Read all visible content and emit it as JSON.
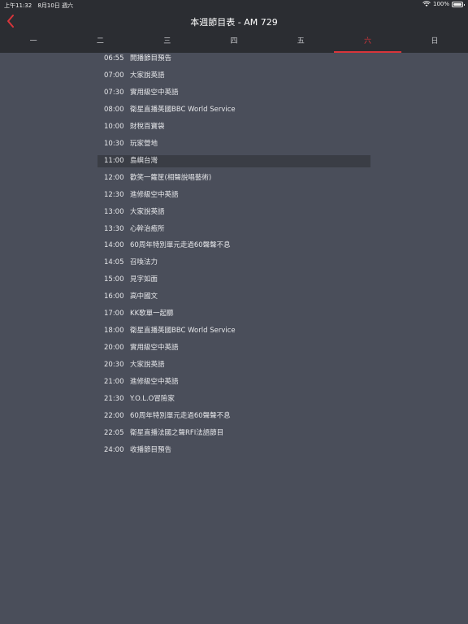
{
  "status": {
    "time": "上午11:32",
    "date": "8月10日 週六",
    "battery": "100%"
  },
  "header": {
    "title": "本週節目表 - AM 729"
  },
  "days": [
    "一",
    "二",
    "三",
    "四",
    "五",
    "六",
    "日"
  ],
  "active_day_index": 5,
  "schedule": [
    {
      "time": "06:55",
      "title": "開播節目預告"
    },
    {
      "time": "07:00",
      "title": "大家說英語"
    },
    {
      "time": "07:30",
      "title": "實用級空中英語"
    },
    {
      "time": "08:00",
      "title": "衛星直播英國BBC World Service"
    },
    {
      "time": "10:00",
      "title": "財稅百寶袋"
    },
    {
      "time": "10:30",
      "title": "玩家營地"
    },
    {
      "time": "11:00",
      "title": "島嶼台灣"
    },
    {
      "time": "12:00",
      "title": "歡笑一籮筐(相聲說唱藝術)"
    },
    {
      "time": "12:30",
      "title": "進修級空中英語"
    },
    {
      "time": "13:00",
      "title": "大家說英語"
    },
    {
      "time": "13:30",
      "title": "心幹治癒所"
    },
    {
      "time": "14:00",
      "title": "60周年特別單元走過60聲聲不息"
    },
    {
      "time": "14:05",
      "title": "召喚法力"
    },
    {
      "time": "15:00",
      "title": "見字如面"
    },
    {
      "time": "16:00",
      "title": "高中國文"
    },
    {
      "time": "17:00",
      "title": "KK歌單一起聽"
    },
    {
      "time": "18:00",
      "title": "衛星直播英國BBC World Service"
    },
    {
      "time": "20:00",
      "title": "實用級空中英語"
    },
    {
      "time": "20:30",
      "title": "大家說英語"
    },
    {
      "time": "21:00",
      "title": "進修級空中英語"
    },
    {
      "time": "21:30",
      "title": "Y.O.L.O冒險家"
    },
    {
      "time": "22:00",
      "title": "60周年特別單元走過60聲聲不息"
    },
    {
      "time": "22:05",
      "title": "衛星直播法國之聲RFI法語節目"
    },
    {
      "time": "24:00",
      "title": "收播節目預告"
    }
  ],
  "highlight_index": 6,
  "colors": {
    "accent": "#d8353b",
    "header_bg": "#2b2d32",
    "content_bg": "#4a4e5a",
    "highlight_bg": "#3a3d45"
  }
}
